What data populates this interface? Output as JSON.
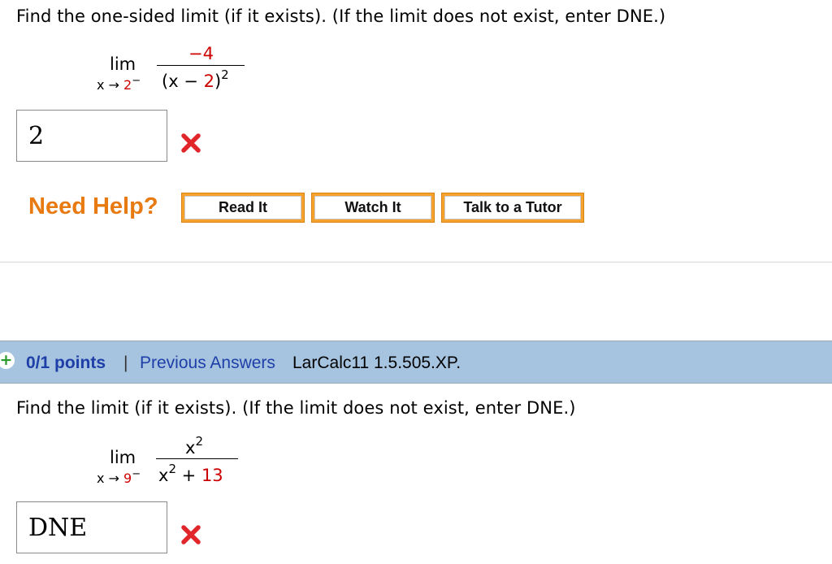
{
  "question1": {
    "prompt": "Find the one-sided limit (if it exists). (If the limit does not exist, enter DNE.)",
    "lim_label": "lim",
    "approach_var": "x → ",
    "approach_value": "2",
    "approach_side": "−",
    "numerator": "−4",
    "denominator_open": "(x − ",
    "denominator_num": "2",
    "denominator_close": ")",
    "denominator_exp": "2",
    "answer": "2",
    "result_icon": "x-mark-icon"
  },
  "help": {
    "label": "Need Help?",
    "read_it": "Read It",
    "watch_it": "Watch It",
    "talk_tutor": "Talk to a Tutor"
  },
  "question2_header": {
    "expand_icon": "plus-icon",
    "points": "0/1 points",
    "separator": "|",
    "previous_answers": "Previous Answers",
    "reference": "LarCalc11 1.5.505.XP."
  },
  "question2": {
    "prompt": "Find the limit (if it exists). (If the limit does not exist, enter DNE.)",
    "lim_label": "lim",
    "approach_var": "x → ",
    "approach_value": "9",
    "approach_side": "−",
    "numerator_base": "x",
    "numerator_exp": "2",
    "denominator_base": "x",
    "denominator_exp": "2",
    "denominator_rest": " + ",
    "denominator_const": "13",
    "answer": "DNE",
    "result_icon": "x-mark-icon"
  },
  "colors": {
    "accent_red": "#cc0000",
    "help_orange": "#e87a12",
    "button_orange": "#f6a12b",
    "header_blue": "#a6c4e0",
    "link_blue": "#1f3fa8"
  }
}
